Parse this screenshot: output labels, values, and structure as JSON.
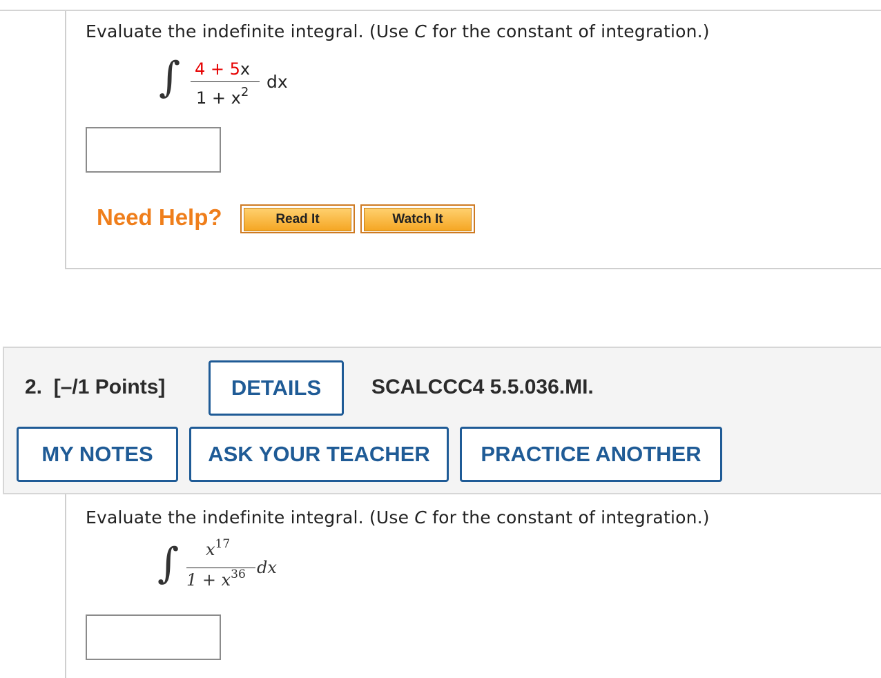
{
  "question1": {
    "prompt_before": "Evaluate the indefinite integral. (Use ",
    "prompt_var": "C",
    "prompt_after": " for the constant of integration.)",
    "integral": {
      "numerator_red": "4 + 5",
      "numerator_var": "x",
      "denominator_base": "1 + x",
      "denominator_exp": "2",
      "differential": "dx"
    },
    "answer_value": "",
    "help": {
      "label": "Need Help?",
      "read_it": "Read It",
      "watch_it": "Watch It"
    }
  },
  "question2": {
    "number": "2.",
    "points": "[–/1 Points]",
    "details_label": "DETAILS",
    "problem_code": "SCALCCC4 5.5.036.MI.",
    "my_notes_label": "MY NOTES",
    "ask_teacher_label": "ASK YOUR TEACHER",
    "practice_another_label": "PRACTICE ANOTHER",
    "prompt_before": "Evaluate the indefinite integral. (Use ",
    "prompt_var": "C",
    "prompt_after": " for the constant of integration.)",
    "integral": {
      "numerator_base": "x",
      "numerator_exp": "17",
      "denominator_base": "1 + x",
      "denominator_exp": "36",
      "differential": "dx"
    },
    "answer_value": ""
  }
}
